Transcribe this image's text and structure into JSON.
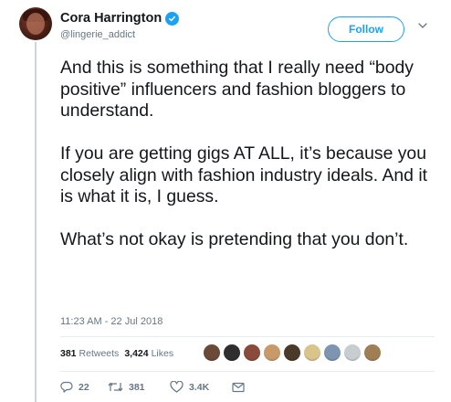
{
  "author": {
    "name": "Cora Harrington",
    "handle": "@lingerie_addict"
  },
  "follow_button_label": "Follow",
  "tweet": {
    "paragraphs": [
      "And this is something that I really need “body positive” influencers and fashion bloggers to understand.",
      "If you are getting gigs AT ALL, it’s because you closely align with fashion industry ideals. And it is what it is, I guess.",
      "What’s not okay is pretending that you don’t."
    ],
    "timestamp": "11:23 AM - 22 Jul 2018"
  },
  "stats": {
    "retweets_count": "381",
    "retweets_label": "Retweets",
    "likes_count": "3,424",
    "likes_label": "Likes"
  },
  "liker_avatar_colors": [
    "#6b4a3a",
    "#2f2f2f",
    "#8a4b3c",
    "#c89a6a",
    "#4a3a2a",
    "#d9c48a",
    "#7d95b0",
    "#c8cdd2",
    "#a07f55"
  ],
  "actions": {
    "reply_count": "22",
    "retweet_count": "381",
    "like_count": "3.4K"
  },
  "colors": {
    "accent": "#1da1f2",
    "text": "#14171a",
    "secondary_text": "#657786",
    "divider": "#e6ecf0"
  },
  "icons": [
    "verified-badge-icon",
    "chevron-down-icon",
    "reply-icon",
    "retweet-icon",
    "like-icon",
    "direct-message-icon"
  ]
}
